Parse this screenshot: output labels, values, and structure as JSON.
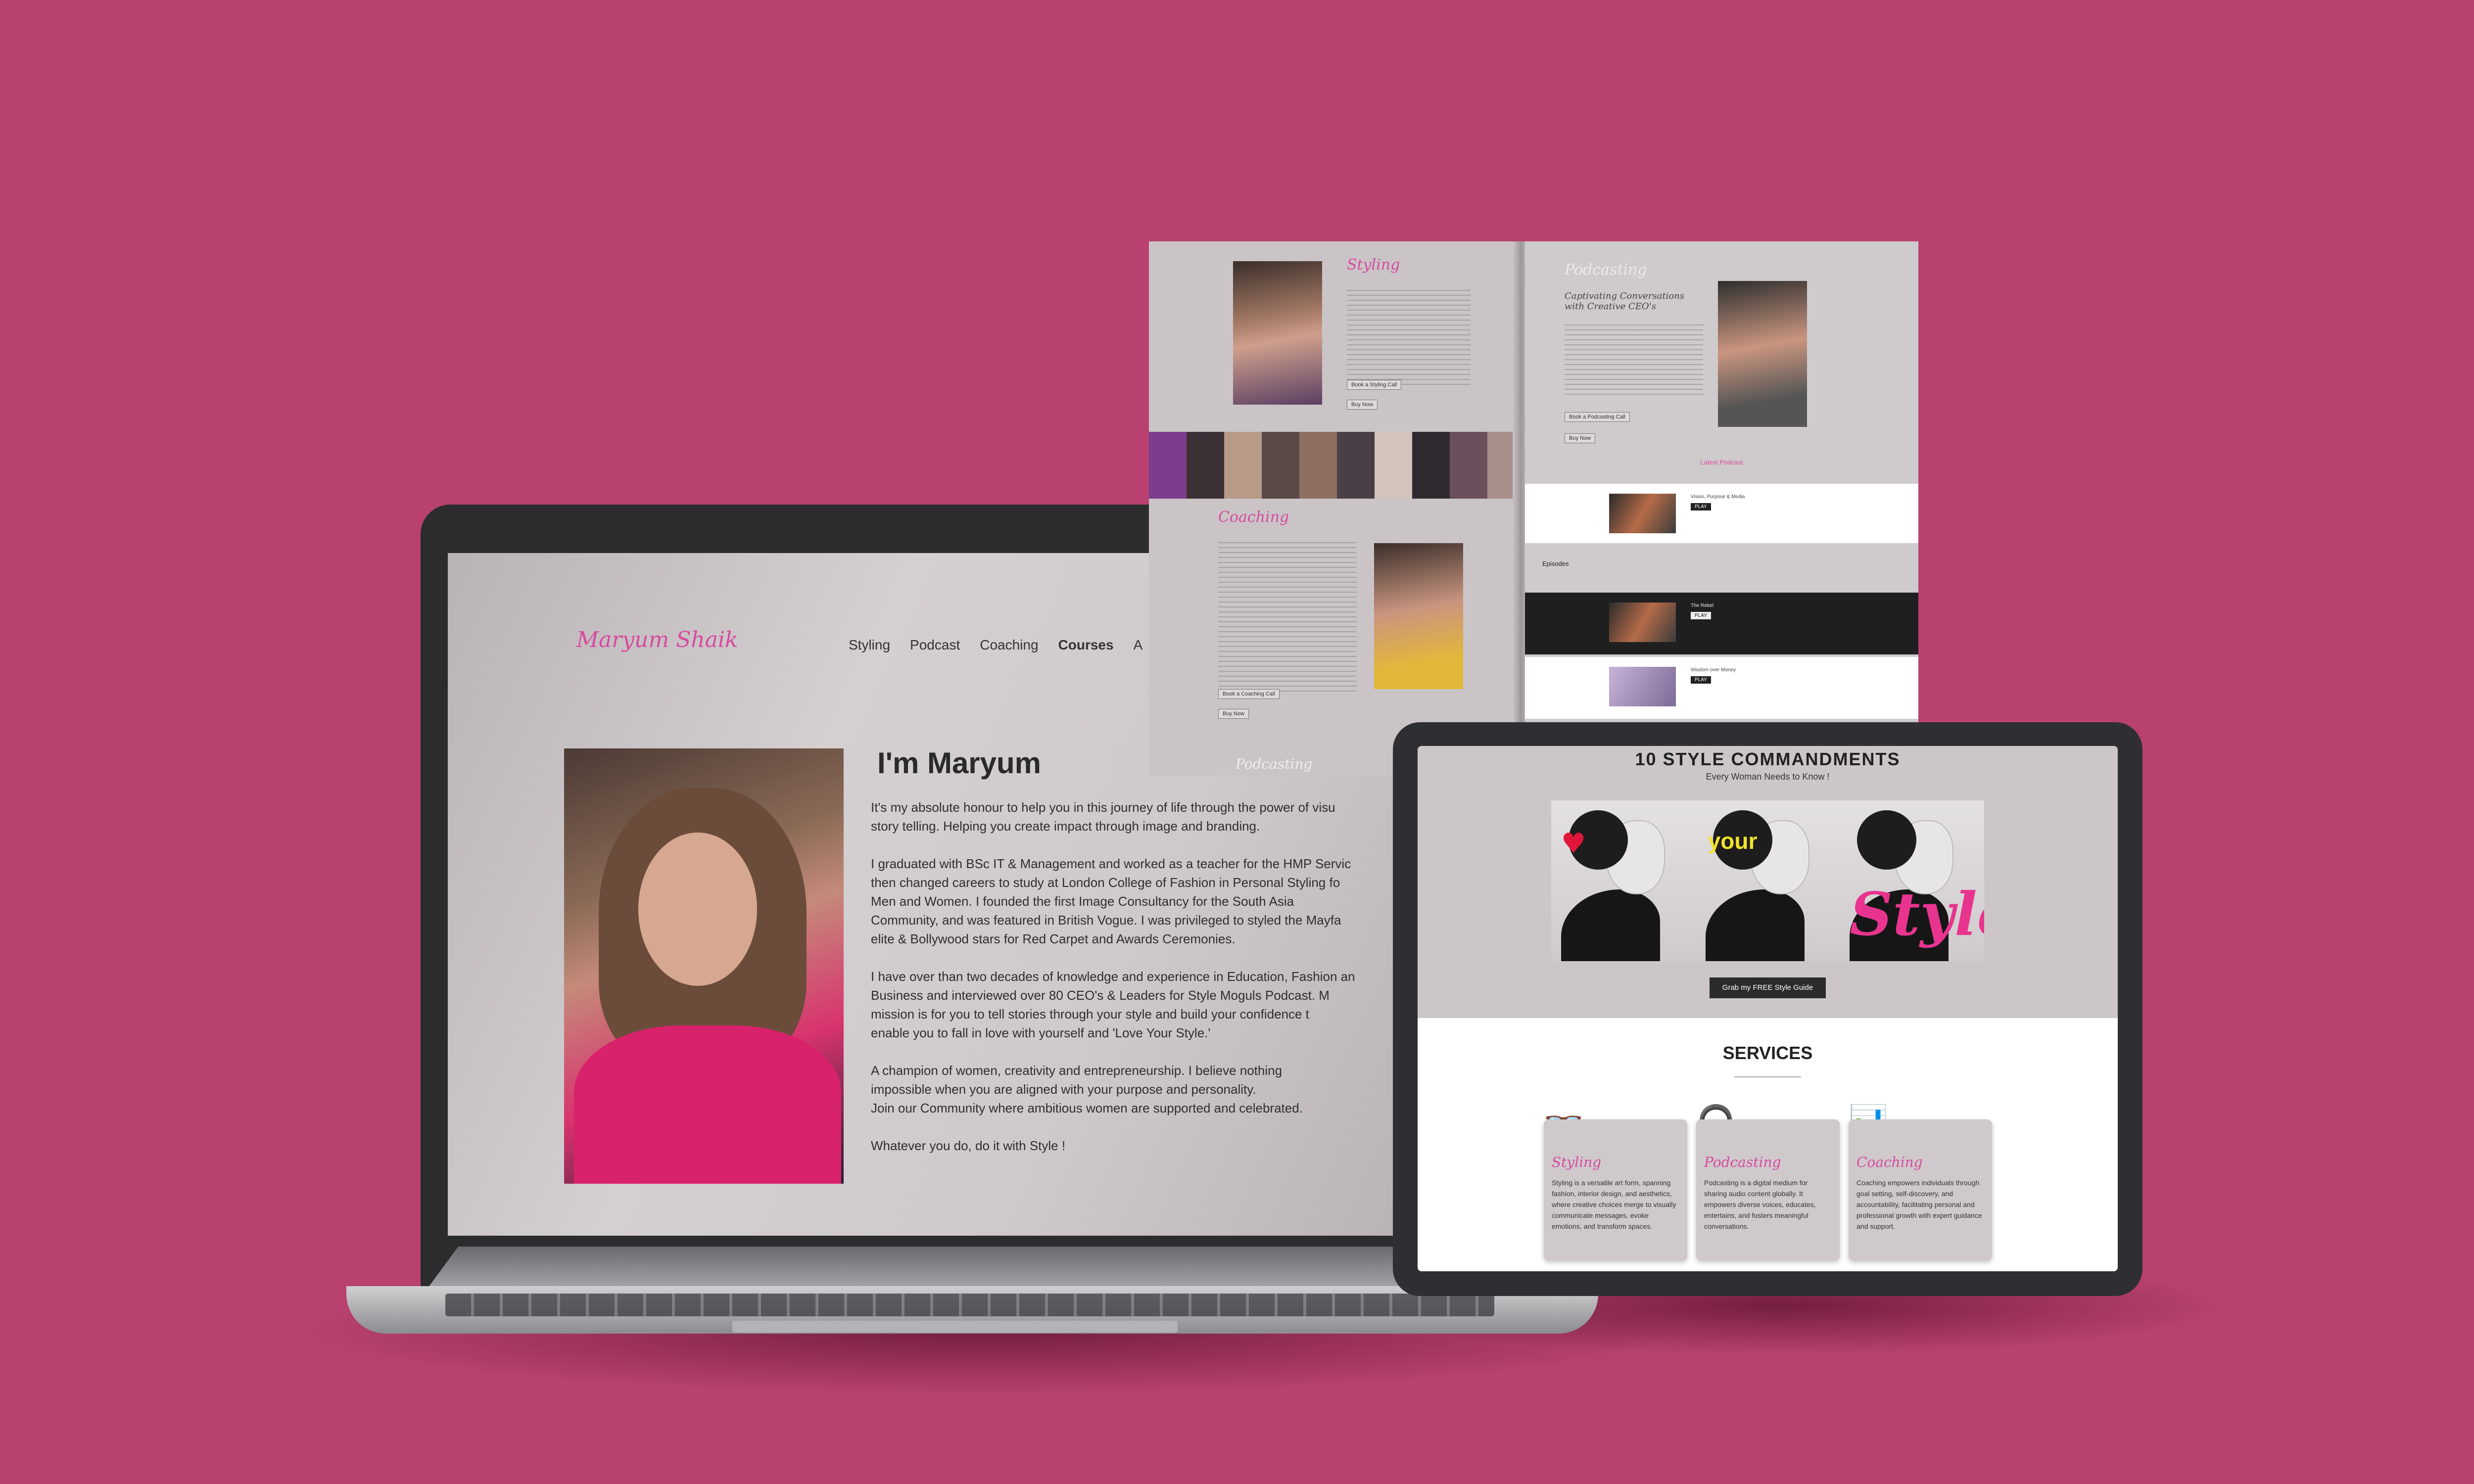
{
  "laptop": {
    "logo": "Maryum Shaik",
    "nav": [
      "Styling",
      "Podcast",
      "Coaching",
      "Courses",
      "A"
    ],
    "heading": "I'm Maryum",
    "paragraphs": [
      "It's my absolute honour to help you in this journey of life through the power of visu\nstory telling. Helping you create impact through image and branding.",
      "I graduated with BSc IT & Management and worked as a teacher for the HMP Servic\nthen changed careers to study at London College of Fashion in Personal Styling fo\nMen and Women. I founded the first Image Consultancy for the South Asia\nCommunity, and was featured in British Vogue. I was privileged to styled the Mayfa\nelite & Bollywood stars for Red Carpet and Awards Ceremonies.",
      "I have over than two decades of knowledge and experience in Education, Fashion an\nBusiness and interviewed over 80 CEO's & Leaders for Style Moguls Podcast. M\nmission is for you to tell stories through your style and build your confidence t\nenable you to fall in love with yourself and 'Love Your Style.'",
      "A champion of women, creativity and entrepreneurship. I believe nothing\nimpossible when you are aligned with your purpose and personality.\nJoin our Community where ambitious women are supported and celebrated.",
      "Whatever you do, do it with Style !"
    ]
  },
  "brochure": {
    "styling_title": "Styling",
    "styling_buttons": [
      "Book a Styling Call",
      "Buy Now"
    ],
    "coaching_title": "Coaching",
    "coaching_buttons": [
      "Book a Coaching Call",
      "Buy Now"
    ],
    "podcasting_title": "Podcasting",
    "podcasting_subtitle": "Captivating Conversations with Creative CEO's",
    "podcasting_button": "Book a Podcasting Call",
    "podcasting_buy": "Buy Now",
    "latest_podcast": "Latest Podcast",
    "episodes_label": "Episodes",
    "footer_script": "Podcasting",
    "episodes": [
      {
        "title": "Vision, Purpose & Media",
        "play": "PLAY"
      },
      {
        "title": "The Rebel",
        "play": "PLAY"
      },
      {
        "title": "Wisdom over Money",
        "play": "PLAY"
      }
    ]
  },
  "tablet": {
    "title": "10 STYLE COMMANDMENTS",
    "subtitle": "Every Woman Needs to Know !",
    "hero_words": [
      "your",
      "Style"
    ],
    "cta": "Grab my FREE Style Guide",
    "services_heading": "SERVICES",
    "services": [
      {
        "name": "Styling",
        "icon": "glasses-icon",
        "text": "Styling is a versatile art form, spanning fashion, interior design, and aesthetics, where creative choices merge to visually communicate messages, evoke emotions, and transform spaces."
      },
      {
        "name": "Podcasting",
        "icon": "headphones-icon",
        "text": "Podcasting is a digital medium for sharing audio content globally. It empowers diverse voices, educates, entertains, and fosters meaningful conversations."
      },
      {
        "name": "Coaching",
        "icon": "presentation-icon",
        "text": "Coaching empowers individuals through goal setting, self-discovery, and accountability, facilitating personal and professional growth with expert guidance and support."
      }
    ]
  },
  "colors": {
    "background": "#b8416f",
    "accent": "#d74aa0",
    "dark": "#2b2b2b"
  }
}
